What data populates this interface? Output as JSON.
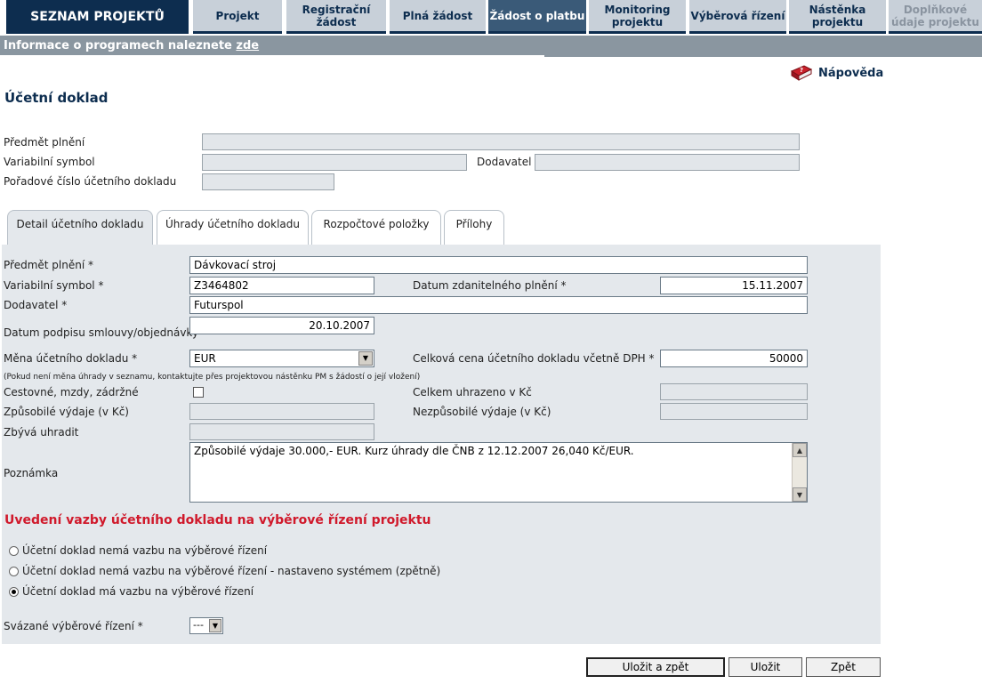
{
  "nav": {
    "brand": "SEZNAM PROJEKTŮ",
    "tabs": [
      {
        "label": "Projekt"
      },
      {
        "label": "Registrační žádost"
      },
      {
        "label": "Plná žádost"
      },
      {
        "label": "Žádost o platbu"
      },
      {
        "label": "Monitoring projektu"
      },
      {
        "label": "Výběrová řízení"
      },
      {
        "label": "Nástěnka projektu"
      },
      {
        "label": "Doplňkové údaje projektu"
      }
    ]
  },
  "infobar": {
    "text": "Informace o programech naleznete ",
    "link": "zde"
  },
  "help": {
    "label": "Nápověda"
  },
  "page_title": "Účetní doklad",
  "summary": {
    "predmet_label": "Předmět plnění",
    "vs_label": "Variabilní symbol",
    "dodavatel_label": "Dodavatel",
    "poradove_label": "Pořadové číslo účetního dokladu"
  },
  "subtabs": [
    {
      "label": "Detail účetního dokladu"
    },
    {
      "label": "Úhrady účetního dokladu"
    },
    {
      "label": "Rozpočtové položky"
    },
    {
      "label": "Přílohy"
    }
  ],
  "form": {
    "predmet_label": "Předmět plnění *",
    "predmet_value": "Dávkovací stroj",
    "vs_label": "Variabilní symbol *",
    "vs_value": "Z3464802",
    "datum_zdanitelneho_label": "Datum zdanitelného plnění *",
    "datum_zdanitelneho_value": "15.11.2007",
    "dodavatel_label": "Dodavatel *",
    "dodavatel_value": "Futurspol",
    "datum_podpisu_label": "Datum podpisu smlouvy/objednávky",
    "datum_podpisu_value": "20.10.2007",
    "mena_label": "Měna účetního dokladu *",
    "mena_value": "EUR",
    "celkova_label": "Celková cena účetního dokladu včetně DPH *",
    "celkova_value": "50000",
    "mena_note": "(Pokud není měna úhrady v seznamu, kontaktujte přes projektovou nástěnku PM s žádostí o její vložení)",
    "cestovne_label": "Cestovné, mzdy, zádržné",
    "celkem_uhrazeno_label": "Celkem uhrazeno v Kč",
    "zpusobile_label": "Způsobilé výdaje (v Kč)",
    "nezpusobile_label": "Nezpůsobilé výdaje (v Kč)",
    "zbyva_label": "Zbývá uhradit",
    "poznamka_label": "Poznámka",
    "poznamka_value": "Způsobilé výdaje 30.000,- EUR. Kurz úhrady dle ČNB z 12.12.2007 26,040 Kč/EUR."
  },
  "vazba": {
    "title": "Uvedení vazby účetního dokladu na výběrové řízení projektu",
    "options": [
      {
        "label": "Účetní doklad nemá vazbu na výběrové řízení",
        "checked": false
      },
      {
        "label": "Účetní doklad nemá vazbu na výběrové řízení - nastaveno systémem (zpětně)",
        "checked": false
      },
      {
        "label": "Účetní doklad má vazbu na výběrové řízení",
        "checked": true
      }
    ],
    "svazane_label": "Svázané výběrové řízení *",
    "svazane_value": "---"
  },
  "buttons": {
    "save_back": "Uložit a zpět",
    "save": "Uložit",
    "back": "Zpět"
  },
  "colors": {
    "nav_dark": "#0d2d4f",
    "tab_bg": "#c8d0d9",
    "active_tab": "#3a5a78",
    "panel_bg": "#e4e8ec",
    "section_red": "#d0192b"
  }
}
